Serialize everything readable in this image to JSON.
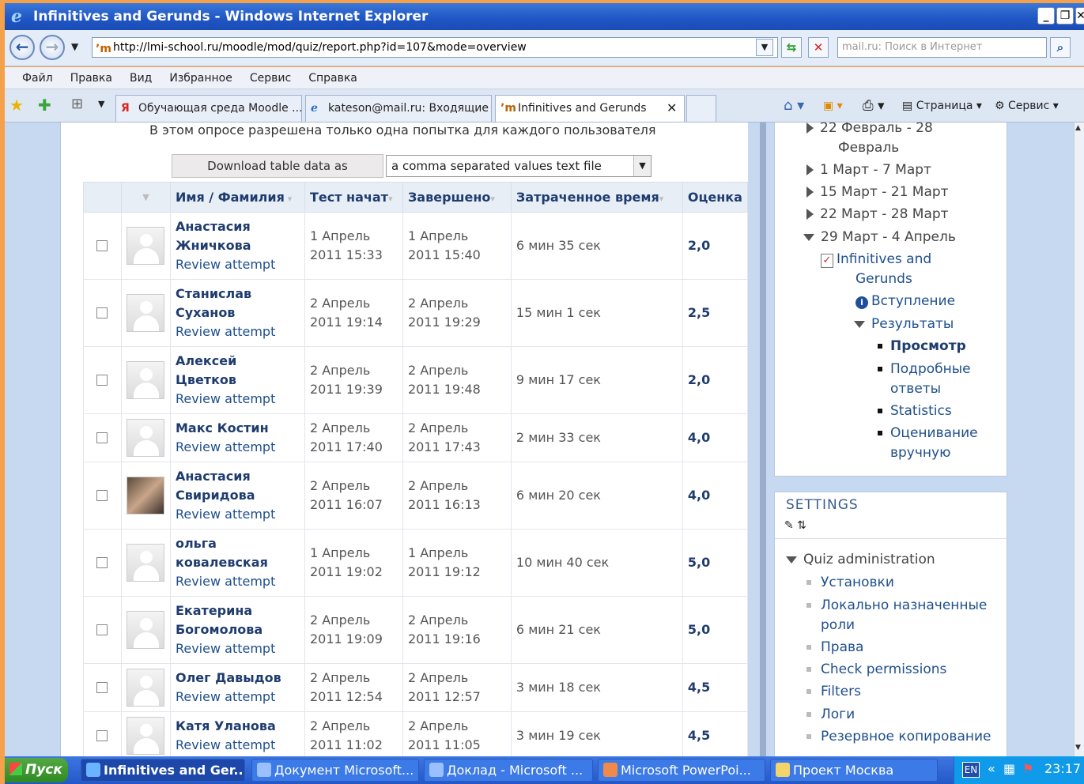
{
  "window": {
    "title": "Infinitives and Gerunds - Windows Internet Explorer"
  },
  "address": {
    "url": "http://lmi-school.ru/moodle/mod/quiz/report.php?id=107&mode=overview",
    "search_placeholder": "mail.ru: Поиск в Интернет"
  },
  "menu": [
    "Файл",
    "Правка",
    "Вид",
    "Избранное",
    "Сервис",
    "Справка"
  ],
  "tabs": [
    {
      "label": "Обучающая среда Moodle ..."
    },
    {
      "label": "kateson@mail.ru: Входящие"
    },
    {
      "label": "Infinitives and Gerunds"
    }
  ],
  "toolbar": {
    "page_label": "Страница",
    "tools_label": "Сервис"
  },
  "main": {
    "notice": "В этом опросе разрешена только одна попытка для каждого пользователя",
    "download_label": "Download table data as",
    "download_format": "a comma separated values text file",
    "columns": [
      "Имя / Фамилия",
      "Тест начат",
      "Завершено",
      "Затраченное время",
      "Оценка"
    ],
    "rows": [
      {
        "first": "Анастасия",
        "last": "Жничкова",
        "review": "Review attempt",
        "start1": "1 Апрель",
        "start2": "2011 15:33",
        "end1": "1 Апрель",
        "end2": "2011 15:40",
        "time": "6 мин 35 сек",
        "grade": "2,0"
      },
      {
        "first": "Станислав",
        "last": "Суханов",
        "review": "Review attempt",
        "start1": "2 Апрель",
        "start2": "2011 19:14",
        "end1": "2 Апрель",
        "end2": "2011 19:29",
        "time": "15 мин 1 сек",
        "grade": "2,5"
      },
      {
        "first": "Алексей",
        "last": "Цветков",
        "review": "Review attempt",
        "start1": "2 Апрель",
        "start2": "2011 19:39",
        "end1": "2 Апрель",
        "end2": "2011 19:48",
        "time": "9 мин 17 сек",
        "grade": "2,0"
      },
      {
        "first": "Макс Костин",
        "last": "",
        "review": "Review attempt",
        "start1": "2 Апрель",
        "start2": "2011 17:40",
        "end1": "2 Апрель",
        "end2": "2011 17:43",
        "time": "2 мин 33 сек",
        "grade": "4,0"
      },
      {
        "first": "Анастасия",
        "last": "Свиридова",
        "review": "Review attempt",
        "start1": "2 Апрель",
        "start2": "2011 16:07",
        "end1": "2 Апрель",
        "end2": "2011 16:13",
        "time": "6 мин 20 сек",
        "grade": "4,0",
        "photo": true
      },
      {
        "first": "ольга",
        "last": "ковалевская",
        "review": "Review attempt",
        "start1": "1 Апрель",
        "start2": "2011 19:02",
        "end1": "1 Апрель",
        "end2": "2011 19:12",
        "time": "10 мин 40 сек",
        "grade": "5,0"
      },
      {
        "first": "Екатерина",
        "last": "Богомолова",
        "review": "Review attempt",
        "start1": "2 Апрель",
        "start2": "2011 19:09",
        "end1": "2 Апрель",
        "end2": "2011 19:16",
        "time": "6 мин 21 сек",
        "grade": "5,0"
      },
      {
        "first": "Олег Давыдов",
        "last": "",
        "review": "Review attempt",
        "start1": "2 Апрель",
        "start2": "2011 12:54",
        "end1": "2 Апрель",
        "end2": "2011 12:57",
        "time": "3 мин 18 сек",
        "grade": "4,5"
      },
      {
        "first": "Катя Уланова",
        "last": "",
        "review": "Review attempt",
        "start1": "2 Апрель",
        "start2": "2011 11:02",
        "end1": "2 Апрель",
        "end2": "2011 11:05",
        "time": "3 мин 19 сек",
        "grade": "4,5"
      }
    ]
  },
  "nav": {
    "weeks": [
      "22 Февраль - 28",
      "Февраль",
      "1 Март - 7 Март",
      "15 Март - 21 Март",
      "22 Март - 28 Март",
      "29 Март - 4 Апрель"
    ],
    "quiz": [
      "Infinitives and",
      "Gerunds"
    ],
    "intro": "Вступление",
    "results": "Результаты",
    "view": "Просмотр",
    "detailed": [
      "Подробные",
      "ответы"
    ],
    "statistics": "Statistics",
    "manual": [
      "Оценивание",
      "вручную"
    ]
  },
  "settings": {
    "title": "SETTINGS",
    "admin": "Quiz administration",
    "items": [
      "Установки",
      "Локально назначенные",
      "роли",
      "Права",
      "Check permissions",
      "Filters",
      "Логи",
      "Резервное копирование"
    ]
  },
  "taskbar": {
    "start": "Пуск",
    "tasks": [
      "Infinitives and Ger...",
      "Документ Microsoft...",
      "Доклад - Microsoft ...",
      "Microsoft PowerPoi...",
      "Проект Москва"
    ],
    "lang": "EN",
    "time": "23:17"
  }
}
